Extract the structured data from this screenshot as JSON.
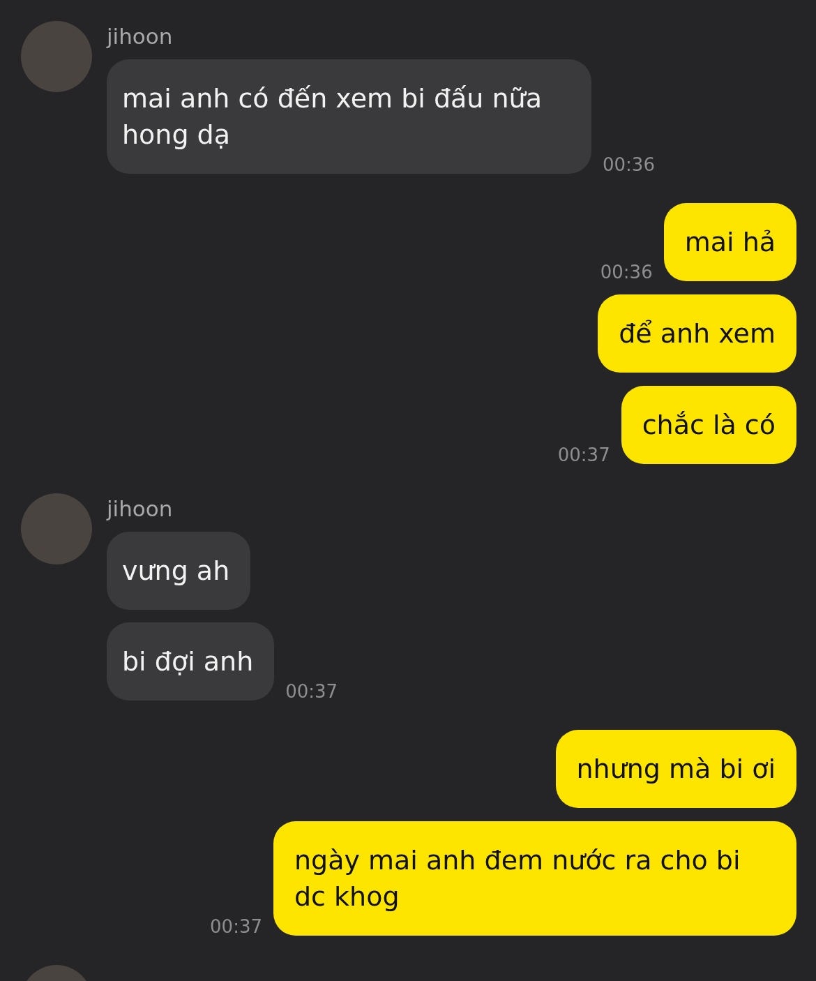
{
  "groups": [
    {
      "kind": "received",
      "sender": "jihoon",
      "messages": [
        {
          "text": "mai anh có đến xem bi đấu nữa hong dạ",
          "time": "00:36"
        }
      ]
    },
    {
      "kind": "sent",
      "messages": [
        {
          "text": "mai hả",
          "time": "00:36"
        },
        {
          "text": "để anh xem"
        },
        {
          "text": "chắc là có",
          "time": "00:37"
        }
      ]
    },
    {
      "kind": "received",
      "sender": "jihoon",
      "messages": [
        {
          "text": "vưng ah"
        },
        {
          "text": "bi đợi anh",
          "time": "00:37"
        }
      ]
    },
    {
      "kind": "sent",
      "messages": [
        {
          "text": "nhưng mà bi ơi"
        },
        {
          "text": "ngày mai anh đem nước ra cho bi dc khog",
          "time": "00:37"
        }
      ]
    },
    {
      "kind": "received"
    }
  ]
}
